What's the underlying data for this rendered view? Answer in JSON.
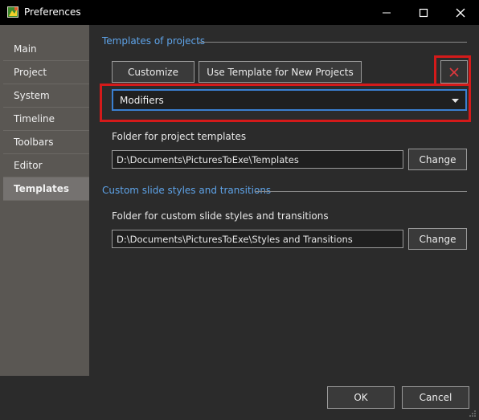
{
  "window": {
    "title": "Preferences"
  },
  "sidebar": {
    "items": [
      {
        "label": "Main"
      },
      {
        "label": "Project"
      },
      {
        "label": "System"
      },
      {
        "label": "Timeline"
      },
      {
        "label": "Toolbars"
      },
      {
        "label": "Editor"
      },
      {
        "label": "Templates",
        "active": true
      }
    ]
  },
  "templates_section": {
    "title": "Templates of projects",
    "customize_label": "Customize",
    "use_template_label": "Use Template for New Projects",
    "dropdown_value": "Modifiers",
    "folder_label": "Folder for project templates",
    "folder_path": "D:\\Documents\\PicturesToExe\\Templates",
    "change_label": "Change"
  },
  "styles_section": {
    "title": "Custom slide styles and transitions",
    "folder_label": "Folder for custom slide styles and transitions",
    "folder_path": "D:\\Documents\\PicturesToExe\\Styles and Transitions",
    "change_label": "Change"
  },
  "footer": {
    "ok_label": "OK",
    "cancel_label": "Cancel"
  },
  "colors": {
    "accent": "#5ea3e8",
    "highlight": "#d41a1a",
    "delete_icon": "#e0393e"
  }
}
